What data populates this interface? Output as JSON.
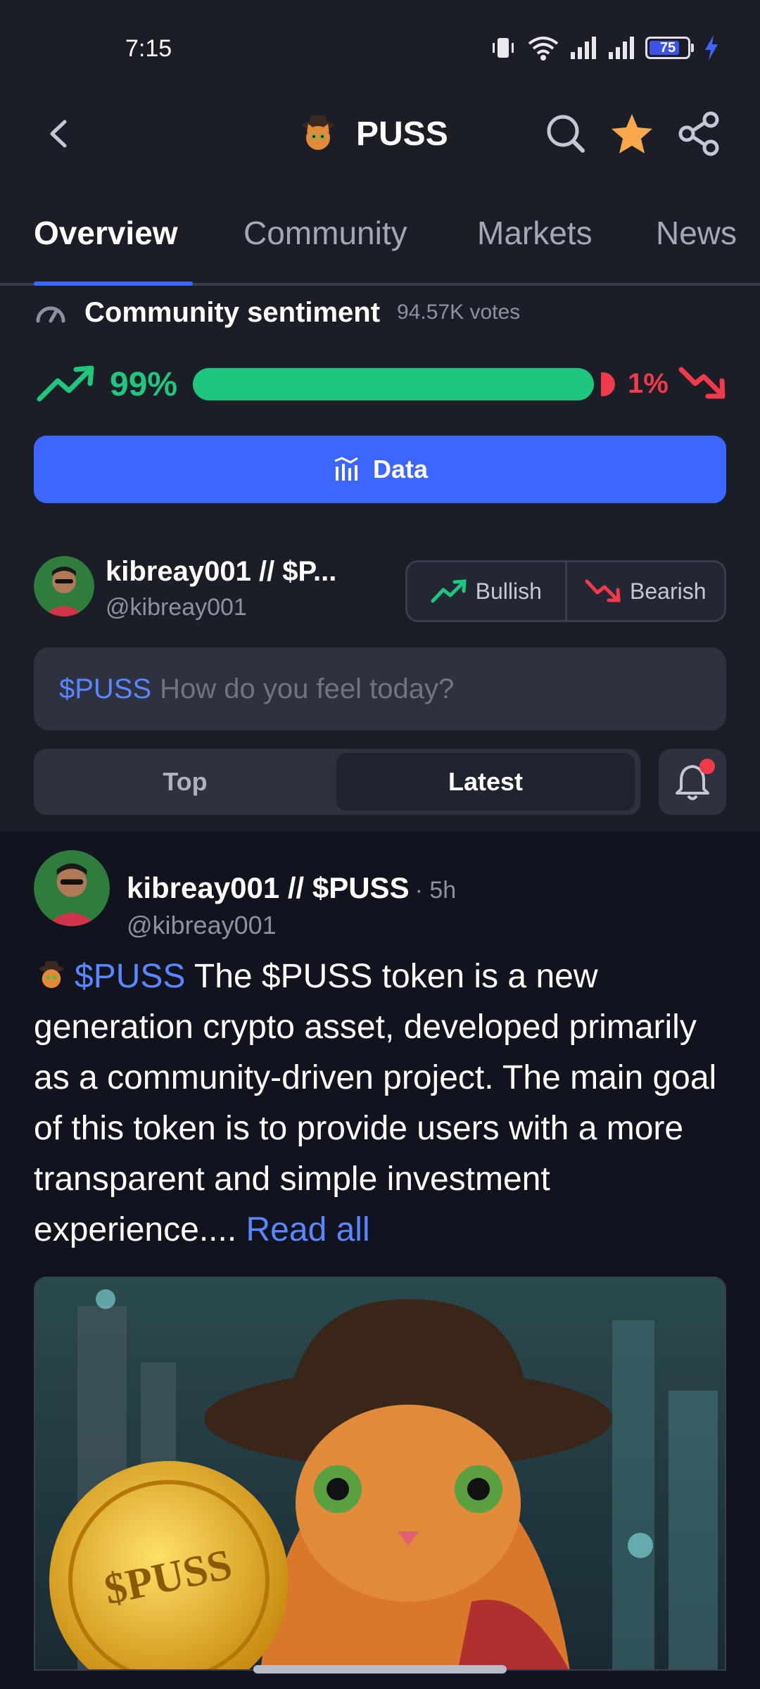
{
  "status": {
    "time": "7:15",
    "battery": "75"
  },
  "header": {
    "title": "PUSS"
  },
  "tabs": [
    {
      "label": "Overview"
    },
    {
      "label": "Community"
    },
    {
      "label": "Markets"
    },
    {
      "label": "News"
    }
  ],
  "sentiment": {
    "title": "Community sentiment",
    "votes": "94.57K votes",
    "bullish_pct": "99%",
    "bearish_pct": "1%",
    "bullish_fraction": 0.99
  },
  "data_button": {
    "label": "Data"
  },
  "composer": {
    "name": "kibreay001 // $P...",
    "handle": "@kibreay001",
    "bullish_label": "Bullish",
    "bearish_label": "Bearish",
    "tag": "$PUSS",
    "placeholder": "How do you feel today?"
  },
  "sort": {
    "top": "Top",
    "latest": "Latest",
    "selected": "Latest"
  },
  "post": {
    "name": "kibreay001 // $PUSS",
    "time": "· 5h",
    "handle": "@kibreay001",
    "tag": "$PUSS",
    "text": "The $PUSS token is a new generation crypto asset, developed primarily as a community-driven project. The main goal of this token is to provide users with a more transparent and simple investment experience....",
    "read_all": "Read all",
    "image_coin_text": "$PUSS"
  },
  "colors": {
    "accent": "#3c66ff",
    "bullish": "#1fc77e",
    "bearish": "#ee3a4a",
    "background": "#1b1d27"
  }
}
